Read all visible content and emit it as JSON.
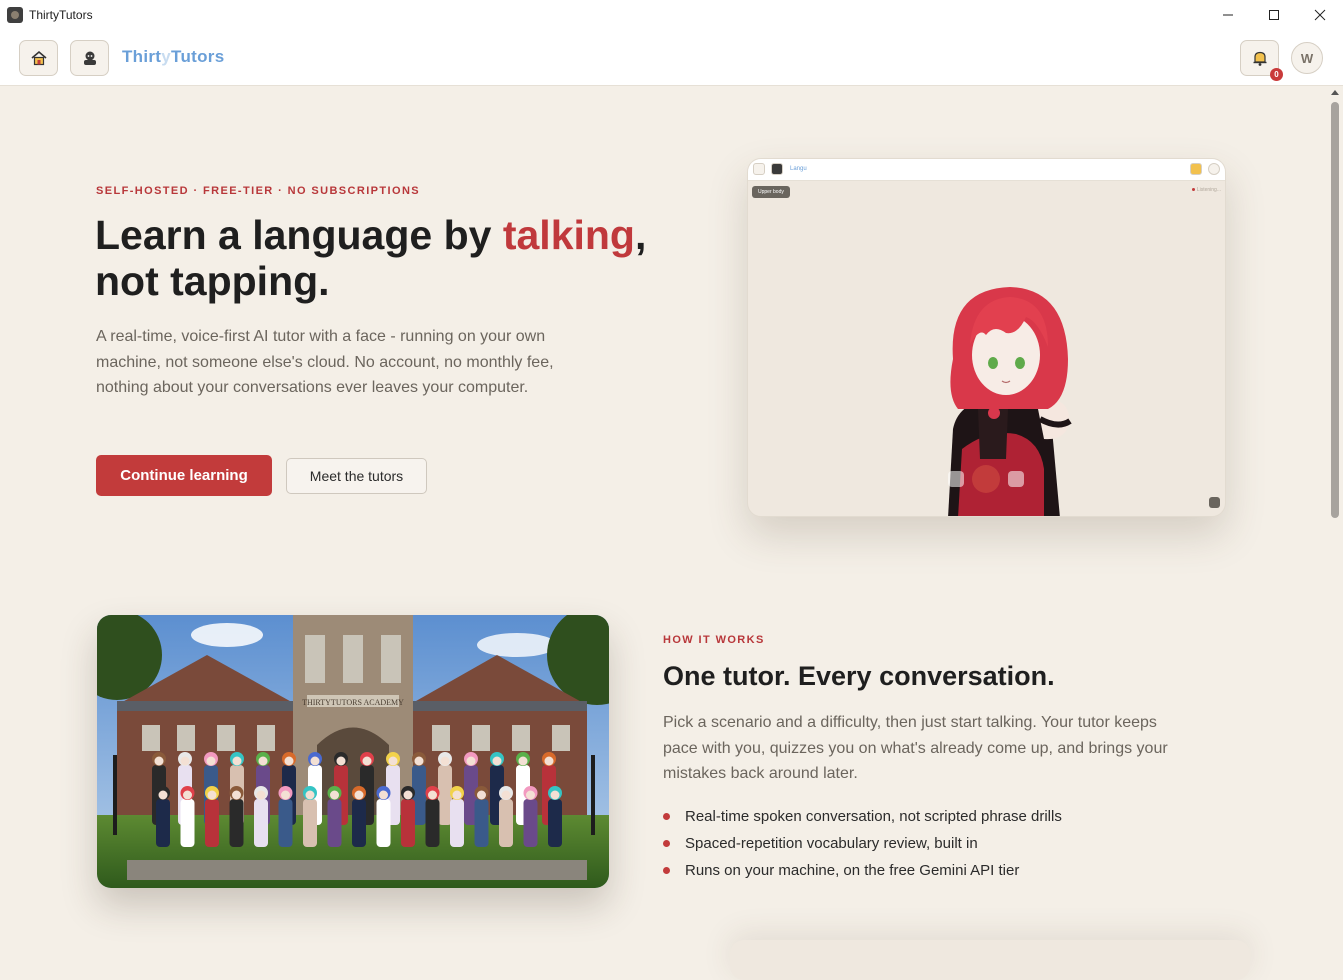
{
  "window": {
    "title": "ThirtyTutors",
    "controls": {
      "minimize": "—",
      "maximize": "☐",
      "close": "✕"
    }
  },
  "header": {
    "brand_main": "Thirt",
    "brand_faded": "y",
    "brand_end": "Tutors",
    "notification_count": "0",
    "avatar_initial": "W"
  },
  "hero": {
    "eyebrow": "SELF-HOSTED · FREE-TIER · NO SUBSCRIPTIONS",
    "title_before": "Learn a language by ",
    "title_accent": "talking",
    "title_after": ", not tapping.",
    "description": "A real-time, voice-first AI tutor with a face - running on your own machine, not someone else's cloud. No account, no monthly fee, nothing about your conversations ever leaves your computer.",
    "primary_button": "Continue learning",
    "secondary_button": "Meet the tutors"
  },
  "preview": {
    "brand": "Langu",
    "mode_pill": "Upper body",
    "status": "Listening..."
  },
  "how": {
    "eyebrow": "HOW IT WORKS",
    "title": "One tutor. Every conversation.",
    "description": "Pick a scenario and a difficulty, then just start talking. Your tutor keeps pace with you, quizzes you on what's already come up, and brings your mistakes back around later.",
    "features": [
      "Real-time spoken conversation, not scripted phrase drills",
      "Spaced-repetition vocabulary review, built in",
      "Runs on your machine, on the free Gemini API tier"
    ],
    "academy_sign": "THIRTYTUTORS ACADEMY"
  },
  "colors": {
    "accent": "#c23b3b",
    "brand_blue": "#6a9fd8",
    "background": "#f4efe7"
  }
}
